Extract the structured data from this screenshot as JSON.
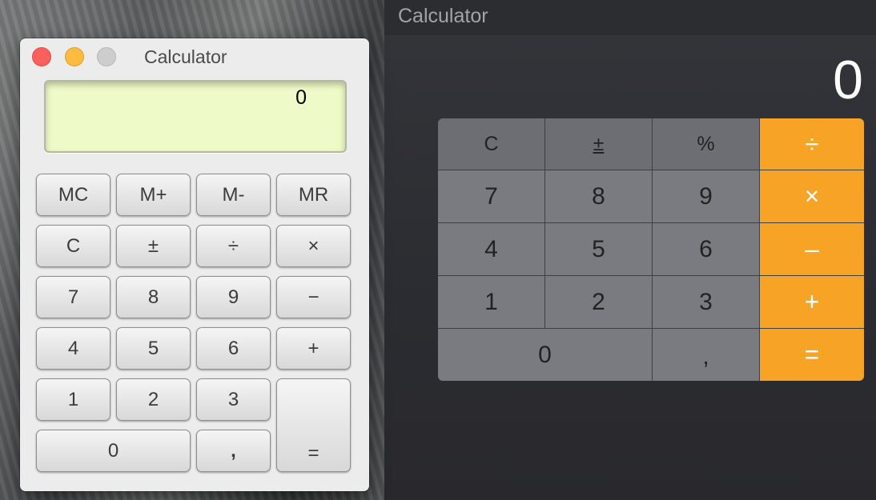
{
  "classic": {
    "title": "Calculator",
    "display": "0",
    "buttons": {
      "mc": "MC",
      "mplus": "M+",
      "mminus": "M-",
      "mr": "MR",
      "clear": "C",
      "plusminus": "±",
      "divide": "÷",
      "multiply": "×",
      "seven": "7",
      "eight": "8",
      "nine": "9",
      "minus": "−",
      "four": "4",
      "five": "5",
      "six": "6",
      "plus": "+",
      "one": "1",
      "two": "2",
      "three": "3",
      "equals": "=",
      "zero": "0",
      "comma": ","
    },
    "colors": {
      "close": "#fc605c",
      "minimize": "#fdbc40",
      "zoom": "#cdcdcd",
      "lcd": "#eefac7"
    }
  },
  "modern": {
    "title": "Calculator",
    "display": "0",
    "keys": {
      "clear": "C",
      "plusminus": "±",
      "percent": "%",
      "divide": "÷",
      "seven": "7",
      "eight": "8",
      "nine": "9",
      "multiply": "×",
      "four": "4",
      "five": "5",
      "six": "6",
      "minus": "–",
      "one": "1",
      "two": "2",
      "three": "3",
      "plus": "+",
      "zero": "0",
      "comma": ",",
      "equals": "="
    },
    "colors": {
      "operator": "#f7a326",
      "function_key": "#6d6e73",
      "digit_key": "#7a7b80"
    }
  }
}
